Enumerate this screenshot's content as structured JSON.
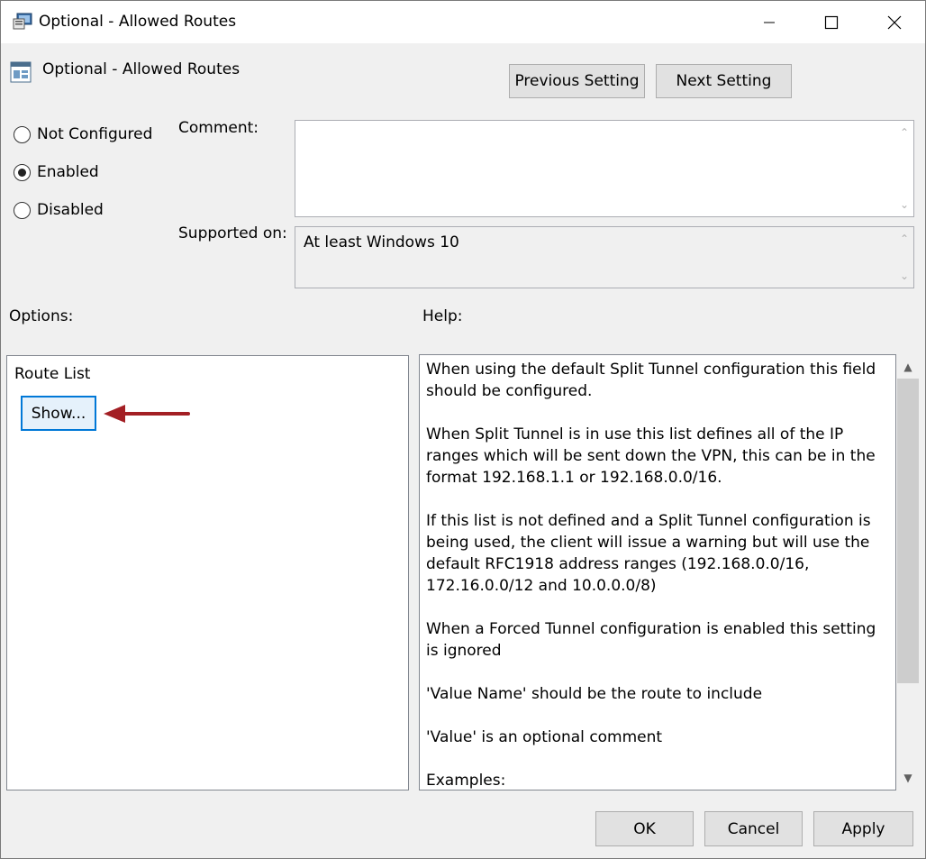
{
  "window": {
    "title": "Optional - Allowed Routes",
    "icon": "policy-icon",
    "controls": [
      "minimize-icon",
      "maximize-icon",
      "close-icon"
    ]
  },
  "header": {
    "title": "Optional - Allowed Routes",
    "icon": "setting-icon",
    "prev_label": "Previous Setting",
    "next_label": "Next Setting"
  },
  "state": {
    "options": [
      {
        "label": "Not Configured",
        "checked": false
      },
      {
        "label": "Enabled",
        "checked": true
      },
      {
        "label": "Disabled",
        "checked": false
      }
    ]
  },
  "comment": {
    "label": "Comment:",
    "value": ""
  },
  "supported": {
    "label": "Supported on:",
    "value": "At least Windows 10"
  },
  "options_section": {
    "label": "Options:",
    "route_list_label": "Route List",
    "show_label": "Show..."
  },
  "help_section": {
    "label": "Help:",
    "paragraphs": [
      "When using the default Split Tunnel configuration this field should be configured.",
      "When Split Tunnel is in use this list defines all of the IP ranges which will be sent down the VPN, this can be in the format 192.168.1.1 or 192.168.0.0/16.",
      "If this list is not defined and a Split Tunnel configuration is being used, the client will issue a warning but will use the default RFC1918 address ranges (192.168.0.0/16, 172.16.0.0/12 and 10.0.0.0/8)",
      "When a Forced Tunnel configuration is enabled this setting is ignored",
      "'Value Name' should be the route to include",
      "'Value' is an optional comment",
      "Examples:"
    ]
  },
  "footer": {
    "ok_label": "OK",
    "cancel_label": "Cancel",
    "apply_label": "Apply"
  },
  "colors": {
    "accent": "#0078d7",
    "annotation_arrow": "#a31f24"
  }
}
